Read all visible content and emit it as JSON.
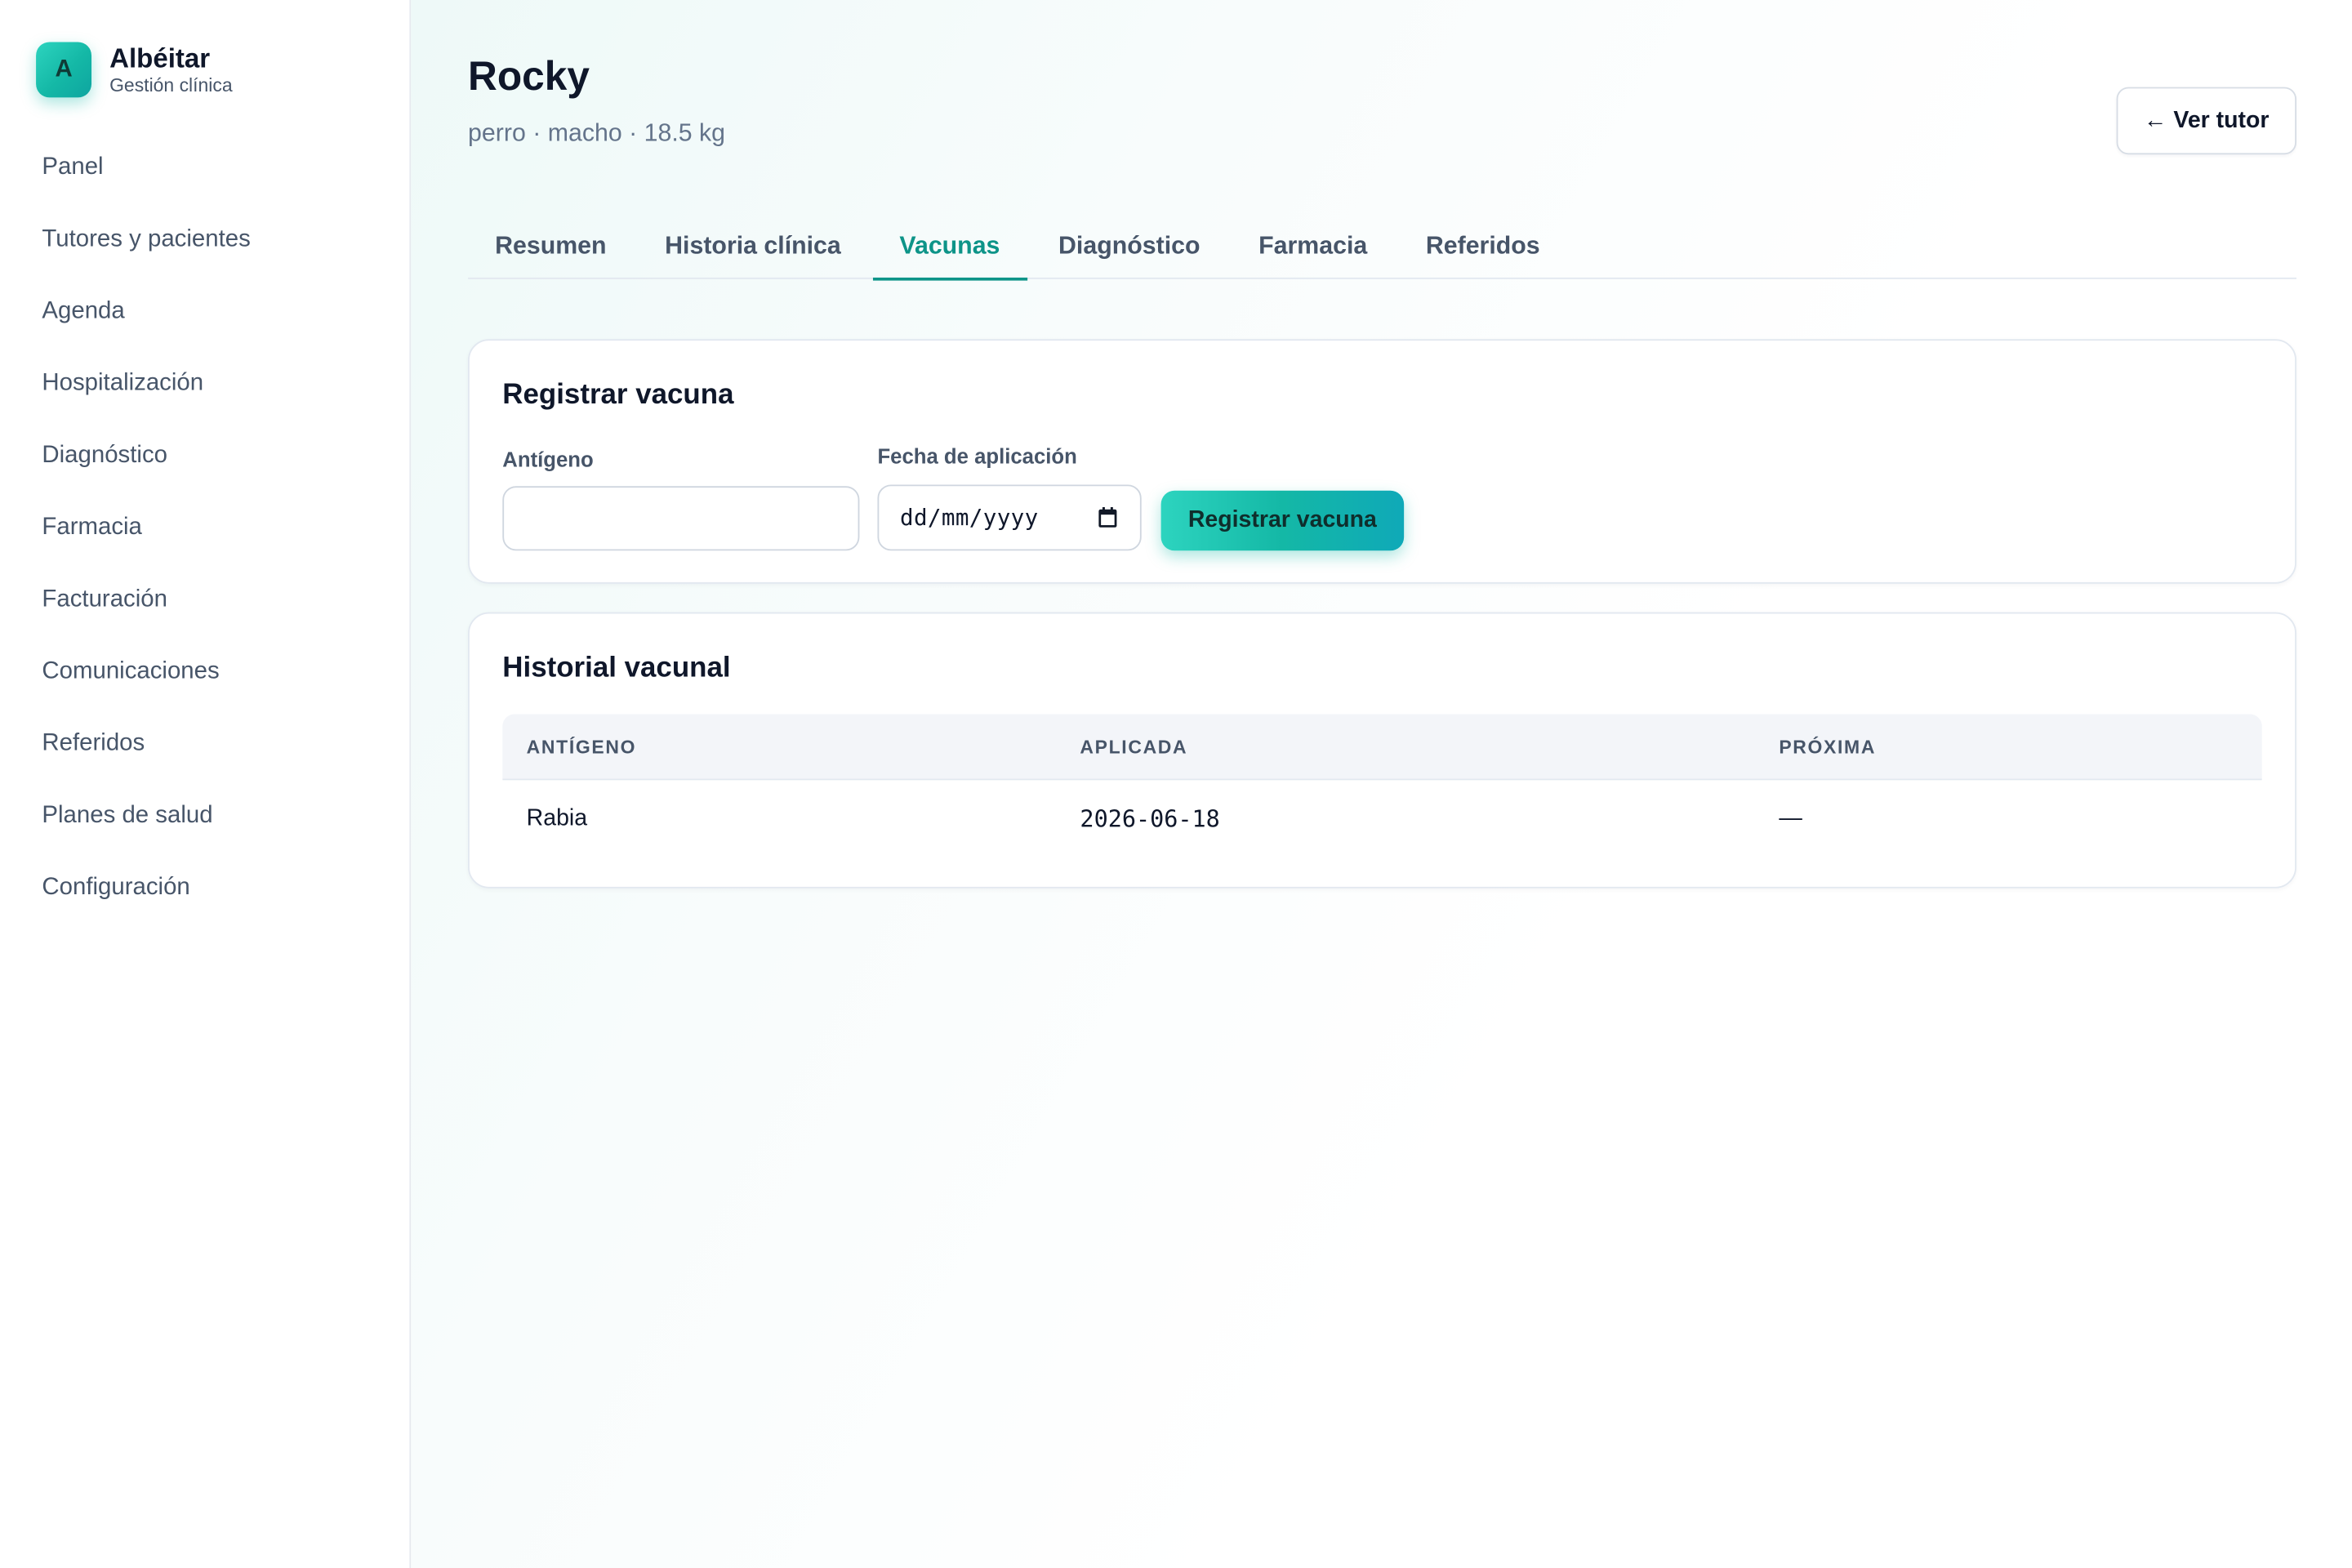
{
  "app": {
    "logo_letter": "A",
    "name": "Albéitar",
    "subtitle": "Gestión clínica",
    "brand_color": "#14b8a6"
  },
  "sidebar": {
    "items": [
      {
        "label": "Panel"
      },
      {
        "label": "Tutores y pacientes"
      },
      {
        "label": "Agenda"
      },
      {
        "label": "Hospitalización"
      },
      {
        "label": "Diagnóstico"
      },
      {
        "label": "Farmacia"
      },
      {
        "label": "Facturación"
      },
      {
        "label": "Comunicaciones"
      },
      {
        "label": "Referidos"
      },
      {
        "label": "Planes de salud"
      },
      {
        "label": "Configuración"
      }
    ]
  },
  "patient": {
    "name": "Rocky",
    "summary": "perro · macho · 18.5 kg"
  },
  "header": {
    "back_label": "← Ver tutor"
  },
  "tabs": [
    {
      "label": "Resumen",
      "active": false
    },
    {
      "label": "Historia clínica",
      "active": false
    },
    {
      "label": "Vacunas",
      "active": true
    },
    {
      "label": "Diagnóstico",
      "active": false
    },
    {
      "label": "Farmacia",
      "active": false
    },
    {
      "label": "Referidos",
      "active": false
    }
  ],
  "register": {
    "title": "Registrar vacuna",
    "antigen_label": "Antígeno",
    "antigen_value": "",
    "date_label": "Fecha de aplicación",
    "date_placeholder": "dd/mm/yyyy",
    "submit_label": "Registrar vacuna"
  },
  "history": {
    "title": "Historial vacunal",
    "columns": [
      "ANTÍGENO",
      "APLICADA",
      "PRÓXIMA"
    ],
    "rows": [
      [
        "Rabia",
        "2026-06-18",
        "—"
      ]
    ]
  },
  "colors": {
    "accent": "#0d9488",
    "text": "#0f172a",
    "muted": "#475569"
  }
}
